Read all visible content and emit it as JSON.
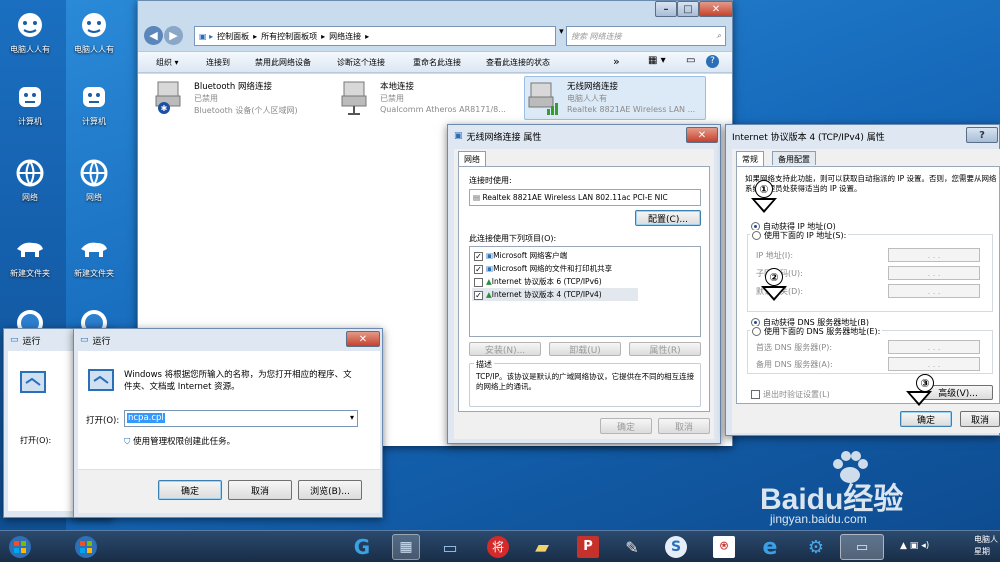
{
  "desktop": {
    "icons": [
      {
        "label": "电脑人人有",
        "glyph": "tiger"
      },
      {
        "label": "计算机",
        "glyph": "tiger2"
      },
      {
        "label": "网络",
        "glyph": "globe"
      },
      {
        "label": "新建文件夹",
        "glyph": "animal"
      }
    ]
  },
  "explorer": {
    "address": [
      "控制面板",
      "所有控制面板项",
      "网络连接"
    ],
    "search_placeholder": "搜索 网络连接",
    "toolbar": [
      "组织 ▾",
      "连接到",
      "禁用此网络设备",
      "诊断这个连接",
      "重命名此连接",
      "查看此连接的状态"
    ],
    "connections": [
      {
        "name": "Bluetooth 网络连接",
        "status": "已禁用",
        "device": "Bluetooth 设备(个人区域网)"
      },
      {
        "name": "本地连接",
        "status": "已禁用",
        "device": "Qualcomm Atheros AR8171/8..."
      },
      {
        "name": "无线网络连接",
        "status": "电脑人人有",
        "device": "Realtek 8821AE Wireless LAN ..."
      }
    ]
  },
  "wireless_props": {
    "title": "无线网络连接 属性",
    "tab": "网络",
    "connect_using_label": "连接时使用:",
    "adapter": "Realtek 8821AE Wireless LAN 802.11ac PCI-E NIC",
    "configure_btn": "配置(C)...",
    "items_label": "此连接使用下列项目(O):",
    "items": [
      {
        "checked": true,
        "label": "Microsoft 网络客户端"
      },
      {
        "checked": true,
        "label": "Microsoft 网络的文件和打印机共享"
      },
      {
        "checked": false,
        "label": "Internet 协议版本 6 (TCP/IPv6)"
      },
      {
        "checked": true,
        "label": "Internet 协议版本 4 (TCP/IPv4)"
      }
    ],
    "install_btn": "安装(N)...",
    "uninstall_btn": "卸载(U)",
    "properties_btn": "属性(R)",
    "desc_title": "描述",
    "desc": "TCP/IP。该协议是默认的广域网络协议，它提供在不同的相互连接的网络上的通讯。",
    "ok_btn": "确定",
    "cancel_btn": "取消"
  },
  "ipv4_props": {
    "title": "Internet 协议版本 4 (TCP/IPv4) 属性",
    "help": "?",
    "tabs": [
      "常规",
      "备用配置"
    ],
    "intro": "如果网络支持此功能，则可以获取自动指派的 IP 设置。否则，您需要从网络系统管理员处获得适当的 IP 设置。",
    "auto_ip": "自动获得 IP 地址(O)",
    "manual_ip": "使用下面的 IP 地址(S):",
    "ip_label": "IP 地址(I):",
    "mask_label": "子网掩码(U):",
    "gateway_label": "默认网关(D):",
    "auto_dns": "自动获得 DNS 服务器地址(B)",
    "manual_dns": "使用下面的 DNS 服务器地址(E):",
    "dns1_label": "首选 DNS 服务器(P):",
    "dns2_label": "备用 DNS 服务器(A):",
    "validate": "退出时验证设置(L)",
    "advanced_btn": "高级(V)...",
    "ok_btn": "确定",
    "cancel_btn": "取消",
    "ip_dots": ". . ."
  },
  "annotations": {
    "one": "①",
    "two": "②",
    "three": "③"
  },
  "run_back": {
    "title": "运行",
    "open_label": "打开(O):"
  },
  "run": {
    "title": "运行",
    "desc": "Windows 将根据您所输入的名称，为您打开相应的程序、文件夹、文档或 Internet 资源。",
    "open_label": "打开(O):",
    "value": "ncpa.cpl",
    "admin_note": "使用管理权限创建此任务。",
    "ok_btn": "确定",
    "cancel_btn": "取消",
    "browse_btn": "浏览(B)..."
  },
  "watermark": {
    "brand": "Baidu经验",
    "url": "jingyan.baidu.com"
  },
  "taskbar": {
    "clock_line1": "电脑人",
    "clock_line2": "星期"
  }
}
